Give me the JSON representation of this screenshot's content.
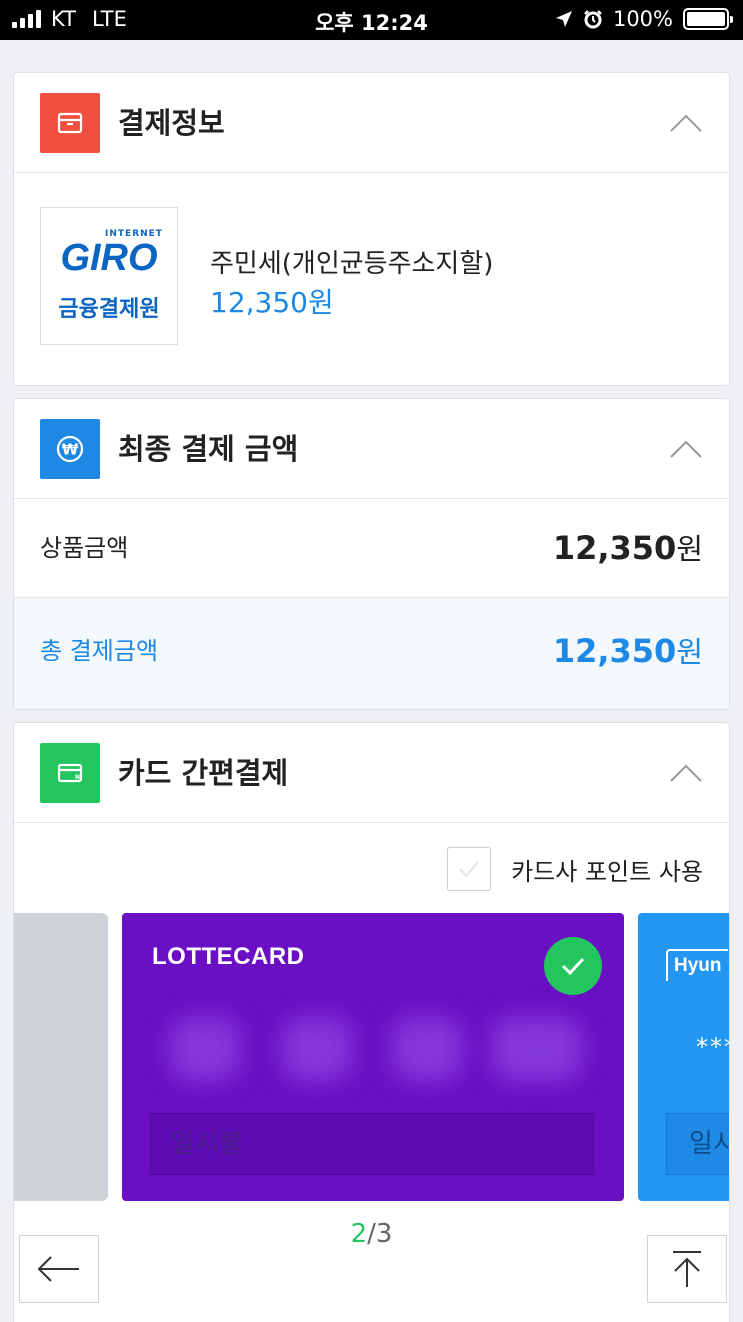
{
  "status_bar": {
    "carrier": "KT",
    "network": "LTE",
    "time": "오후 12:24",
    "battery": "100%"
  },
  "payment_info": {
    "title": "결제정보",
    "icon": "box-icon",
    "icon_color": "#f04e3e",
    "merchant_logo": {
      "top": "INTERNET",
      "brand": "GIRO",
      "korean": "금융결제원"
    },
    "product_name": "주민세(개인균등주소지할)",
    "product_price": "12,350원"
  },
  "final_amount": {
    "title": "최종 결제 금액",
    "icon": "won-icon",
    "icon_color": "#1e88e5",
    "product_amount_label": "상품금액",
    "product_amount_value": "12,350",
    "product_amount_unit": "원",
    "total_label": "총 결제금액",
    "total_value": "12,350",
    "total_unit": "원"
  },
  "card_pay": {
    "title": "카드 간편결제",
    "icon": "card-icon",
    "icon_color": "#22c55e",
    "points_label": "카드사 포인트 사용",
    "points_checked": false,
    "current_card": {
      "brand": "LOTTECARD",
      "color": "#6a0fc4",
      "installment": "일시불",
      "selected": true
    },
    "next_card": {
      "brand": "Hyun",
      "color": "#2196f3",
      "masked": "***",
      "installment": "일시"
    },
    "pager_current": "2",
    "pager_total": "/3"
  },
  "controls": {
    "back": "back-arrow-icon",
    "scroll_top": "scroll-top-icon"
  }
}
